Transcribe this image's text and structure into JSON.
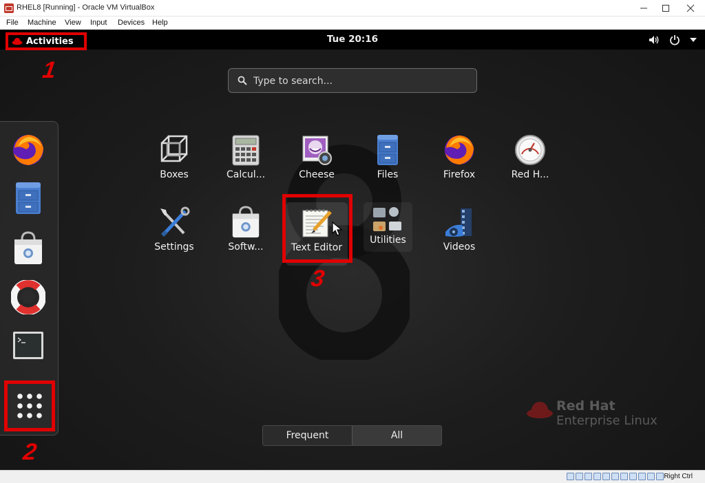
{
  "window": {
    "title": "RHEL8 [Running] - Oracle VM VirtualBox",
    "menu": [
      "File",
      "Machine",
      "View",
      "Input",
      "Devices",
      "Help"
    ]
  },
  "topbar": {
    "activities_label": "Activities",
    "clock": "Tue 20:16"
  },
  "search": {
    "placeholder": "Type to search..."
  },
  "markers": [
    "1",
    "2",
    "3"
  ],
  "dash": {
    "items": [
      "firefox-icon",
      "files-icon",
      "software-icon",
      "help-icon",
      "terminal-icon"
    ],
    "show_apps_icon": "grid-icon"
  },
  "apps": [
    {
      "name": "Boxes",
      "icon": "boxes-icon"
    },
    {
      "name": "Calcul...",
      "icon": "calculator-icon"
    },
    {
      "name": "Cheese",
      "icon": "cheese-icon"
    },
    {
      "name": "Files",
      "icon": "files-icon"
    },
    {
      "name": "Firefox",
      "icon": "firefox-icon"
    },
    {
      "name": "Red H...",
      "icon": "gauge-icon"
    },
    {
      "name": "Settings",
      "icon": "tools-icon"
    },
    {
      "name": "Softw...",
      "icon": "software-icon"
    },
    {
      "name": "Text Editor",
      "icon": "text-editor-icon"
    },
    {
      "name": "Utilities",
      "icon": "utilities-folder-icon"
    },
    {
      "name": "Videos",
      "icon": "videos-icon"
    }
  ],
  "view_switcher": {
    "frequent": "Frequent",
    "all": "All",
    "active": "all"
  },
  "branding": {
    "line1": "Red Hat",
    "line2": "Enterprise Linux"
  },
  "statusbar": {
    "host_key": "Right Ctrl"
  },
  "colors": {
    "annotation_red": "#e00000",
    "topbar": "#000000",
    "accent_blue": "#3b7dd8"
  }
}
